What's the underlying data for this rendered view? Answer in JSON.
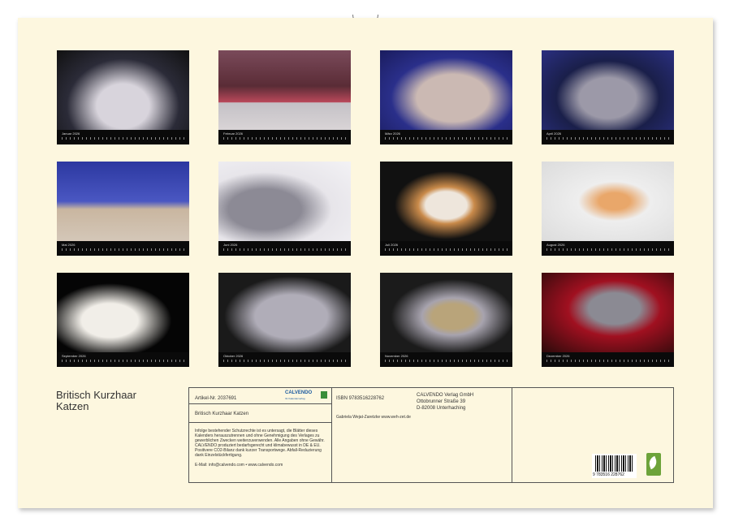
{
  "calendar_title": "Britisch Kurzhaar Katzen",
  "months": [
    {
      "label": "Januar",
      "year": "2026"
    },
    {
      "label": "Februar",
      "year": "2026"
    },
    {
      "label": "März",
      "year": "2026"
    },
    {
      "label": "April",
      "year": "2026"
    },
    {
      "label": "Mai",
      "year": "2026"
    },
    {
      "label": "Juni",
      "year": "2026"
    },
    {
      "label": "Juli",
      "year": "2026"
    },
    {
      "label": "August",
      "year": "2026"
    },
    {
      "label": "September",
      "year": "2026"
    },
    {
      "label": "Oktober",
      "year": "2026"
    },
    {
      "label": "November",
      "year": "2026"
    },
    {
      "label": "Dezember",
      "year": "2026"
    }
  ],
  "info": {
    "article_no": "Artikel-Nr. 2037691",
    "brand": "CALVENDO",
    "brand_sub": "Ihr Kalenderverlag",
    "product_title": "Britisch Kurzhaar Katzen",
    "legal_text": "Infolge bestehender Schutzrechte ist es untersagt, die Blätter dieses Kalenders herauszutrennen und ohne Genehmigung des Verlages zu gewerblichen Zwecken weiterzuverwenden. Alle Angaben ohne Gewähr. CALVENDO produziert bedarfsgerecht und klimabewusst in DE & EU. Positivere CO2-Bilanz dank kurzer Transportwege. Abfall-Reduzierung dank Einzelstückfertigung.",
    "contact": "E-Mail: info@calvendo.com • www.calvendo.com",
    "isbn": "ISBN 9783516228762",
    "publisher_lines": [
      "CALVENDO Verlag GmbH",
      "Ottobrunner Straße 39",
      "D-82008 Unterhaching"
    ],
    "author": "Gabriela Wejat-Zaretzke www.weh-zet.de",
    "barcode_text": "9 783516 228762"
  },
  "colors": {
    "page": "#fdf7df",
    "frame": "#000000",
    "green_badge": "#6da33a"
  }
}
